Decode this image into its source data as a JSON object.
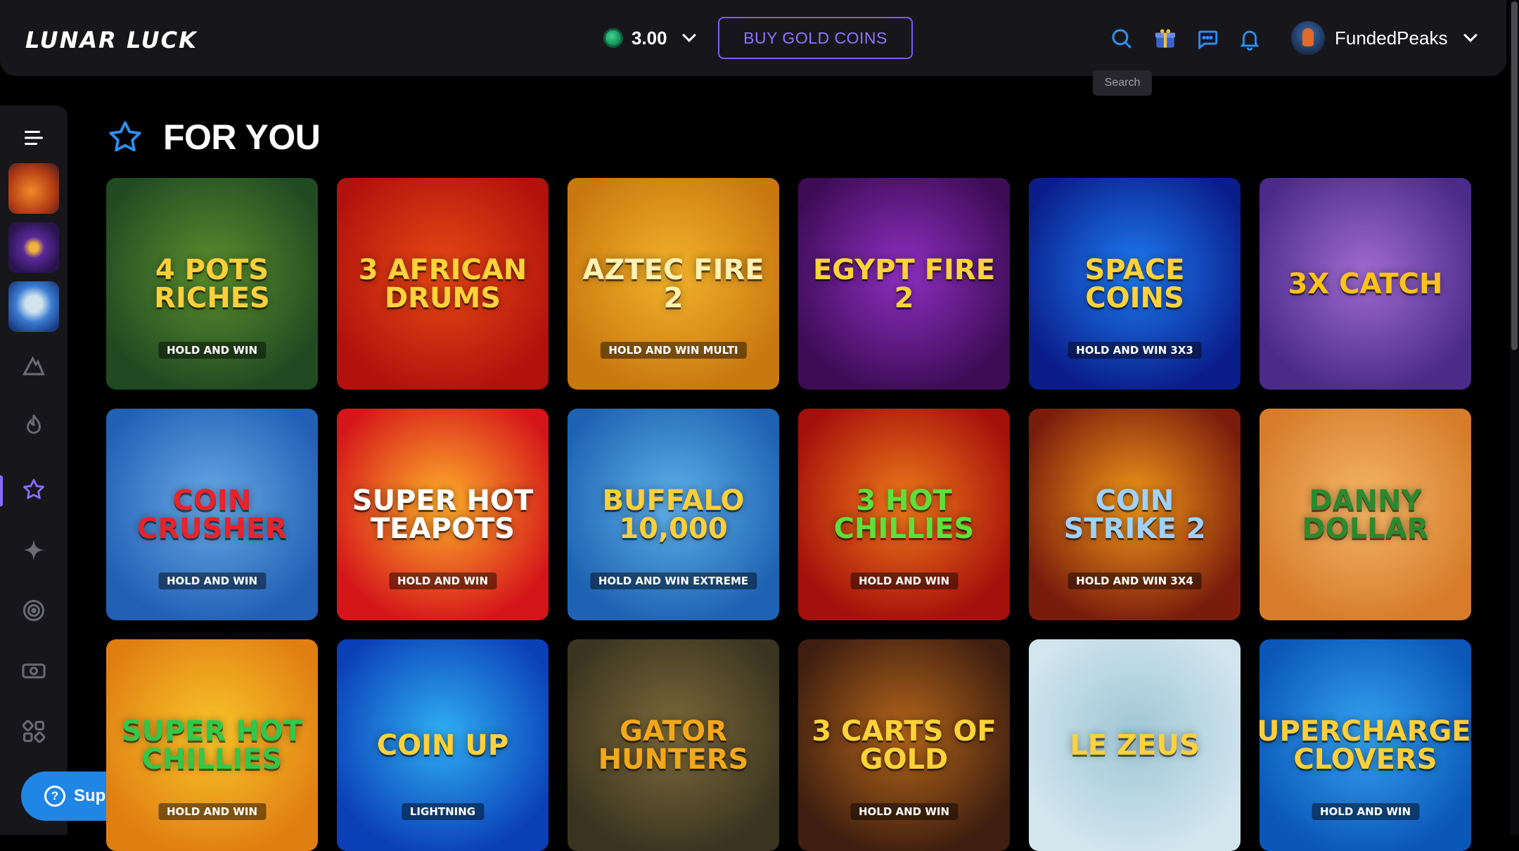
{
  "header": {
    "logo": "LUNAR LUCK",
    "balance": "3.00",
    "buy_label": "BUY GOLD COINS",
    "search_tooltip": "Search",
    "username": "FundedPeaks"
  },
  "sidebar": {
    "items": [
      {
        "name": "menu-toggle-icon"
      },
      {
        "name": "rocket-game-icon"
      },
      {
        "name": "planet-game-icon"
      },
      {
        "name": "alien-game-icon"
      },
      {
        "name": "mountain-icon"
      },
      {
        "name": "fire-icon"
      },
      {
        "name": "star-icon"
      },
      {
        "name": "sparkle-icon"
      },
      {
        "name": "target-icon"
      },
      {
        "name": "ticket-icon"
      },
      {
        "name": "dice-icon"
      }
    ]
  },
  "support": {
    "label": "Support"
  },
  "section": {
    "title": "FOR YOU"
  },
  "games": [
    {
      "title": "4 Pots Riches",
      "sub": "HOLD AND WIN",
      "bg": "#1f4a22",
      "bg2": "#5b8f2e",
      "fg": "#ffcf3a"
    },
    {
      "title": "3 African Drums",
      "sub": "",
      "bg": "#b1120d",
      "bg2": "#e84a14",
      "fg": "#ffd23a"
    },
    {
      "title": "Aztec Fire 2",
      "sub": "HOLD AND WIN MULTI",
      "bg": "#c9770f",
      "bg2": "#f2b32a",
      "fg": "#fff1b0"
    },
    {
      "title": "Egypt Fire 2",
      "sub": "",
      "bg": "#3d0c55",
      "bg2": "#8e2fc1",
      "fg": "#ffd23a"
    },
    {
      "title": "Space Coins",
      "sub": "HOLD AND WIN 3X3",
      "bg": "#0a1d8a",
      "bg2": "#1d7cf2",
      "fg": "#ffd23a"
    },
    {
      "title": "3x Catch",
      "sub": "",
      "bg": "#4a2b8a",
      "bg2": "#a06bd0",
      "fg": "#ffc21a"
    },
    {
      "title": "Coin Crusher",
      "sub": "HOLD AND WIN",
      "bg": "#2160b5",
      "bg2": "#6aa9e6",
      "fg": "#e8232a"
    },
    {
      "title": "Super Hot Teapots",
      "sub": "HOLD AND WIN",
      "bg": "#d4161a",
      "bg2": "#ffb12a",
      "fg": "#ffffff"
    },
    {
      "title": "Buffalo 10,000",
      "sub": "HOLD AND WIN EXTREME",
      "bg": "#1e63b3",
      "bg2": "#5fb0e8",
      "fg": "#ffcf3a"
    },
    {
      "title": "3 Hot Chillies",
      "sub": "HOLD AND WIN",
      "bg": "#a30f0b",
      "bg2": "#f07a1a",
      "fg": "#5ee03a"
    },
    {
      "title": "Coin Strike 2",
      "sub": "HOLD AND WIN 3X4",
      "bg": "#7a1c0c",
      "bg2": "#f29a1a",
      "fg": "#9fd2ff"
    },
    {
      "title": "Danny Dollar",
      "sub": "",
      "bg": "#d67c2a",
      "bg2": "#f4b768",
      "fg": "#2c8a2e"
    },
    {
      "title": "Super Hot Chillies",
      "sub": "HOLD AND WIN",
      "bg": "#e07e12",
      "bg2": "#f9c62a",
      "fg": "#2fc94a"
    },
    {
      "title": "Coin Up",
      "sub": "LIGHTNING",
      "bg": "#0b3fb8",
      "bg2": "#2fb0f2",
      "fg": "#ffd23a"
    },
    {
      "title": "Gator Hunters",
      "sub": "",
      "bg": "#3a3320",
      "bg2": "#7d6b3a",
      "fg": "#f2a81a"
    },
    {
      "title": "3 Carts of Gold",
      "sub": "HOLD AND WIN",
      "bg": "#3e1e10",
      "bg2": "#b5661a",
      "fg": "#ffd23a"
    },
    {
      "title": "Le Zeus",
      "sub": "",
      "bg": "#d2e6ee",
      "bg2": "#9fc6d6",
      "fg": "#ffd23a"
    },
    {
      "title": "Supercharged Clovers",
      "sub": "HOLD AND WIN",
      "bg": "#0a57b8",
      "bg2": "#36a4f0",
      "fg": "#ffcf3a"
    }
  ],
  "colors": {
    "accent": "#8a6cff",
    "support": "#1f86e6",
    "panel": "#17171b"
  }
}
